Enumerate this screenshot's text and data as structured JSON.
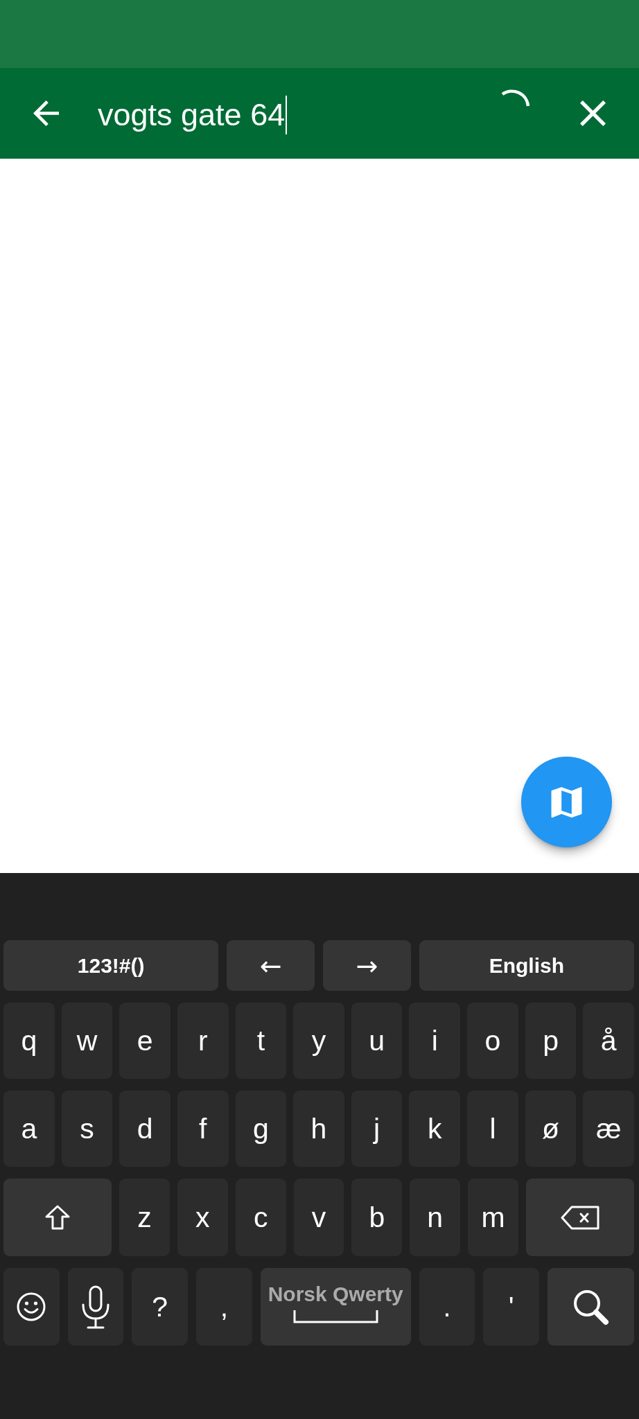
{
  "search_bar": {
    "query": "vogts gate 64",
    "loading": true
  },
  "keyboard": {
    "rows": [
      {
        "keys": [
          {
            "kind": "text",
            "label": "123!#()"
          },
          {
            "kind": "nav",
            "label": "←"
          },
          {
            "kind": "nav",
            "label": "→"
          },
          {
            "kind": "text",
            "label": "English"
          }
        ]
      },
      {
        "keys": [
          {
            "kind": "char",
            "label": "q"
          },
          {
            "kind": "char",
            "label": "w"
          },
          {
            "kind": "char",
            "label": "e"
          },
          {
            "kind": "char",
            "label": "r"
          },
          {
            "kind": "char",
            "label": "t"
          },
          {
            "kind": "char",
            "label": "y"
          },
          {
            "kind": "char",
            "label": "u"
          },
          {
            "kind": "char",
            "label": "i"
          },
          {
            "kind": "char",
            "label": "o"
          },
          {
            "kind": "char",
            "label": "p"
          },
          {
            "kind": "char",
            "label": "å"
          }
        ]
      },
      {
        "keys": [
          {
            "kind": "char",
            "label": "a"
          },
          {
            "kind": "char",
            "label": "s"
          },
          {
            "kind": "char",
            "label": "d"
          },
          {
            "kind": "char",
            "label": "f"
          },
          {
            "kind": "char",
            "label": "g"
          },
          {
            "kind": "char",
            "label": "h"
          },
          {
            "kind": "char",
            "label": "j"
          },
          {
            "kind": "char",
            "label": "k"
          },
          {
            "kind": "char",
            "label": "l"
          },
          {
            "kind": "char",
            "label": "ø"
          },
          {
            "kind": "char",
            "label": "æ"
          }
        ]
      },
      {
        "keys": [
          {
            "kind": "shift"
          },
          {
            "kind": "char",
            "label": "z"
          },
          {
            "kind": "char",
            "label": "x"
          },
          {
            "kind": "char",
            "label": "c"
          },
          {
            "kind": "char",
            "label": "v"
          },
          {
            "kind": "char",
            "label": "b"
          },
          {
            "kind": "char",
            "label": "n"
          },
          {
            "kind": "char",
            "label": "m"
          },
          {
            "kind": "backspace"
          }
        ]
      },
      {
        "keys": [
          {
            "kind": "emoji"
          },
          {
            "kind": "mic"
          },
          {
            "kind": "char",
            "label": "?"
          },
          {
            "kind": "char",
            "label": ","
          },
          {
            "kind": "space",
            "label": "Norsk Qwerty"
          },
          {
            "kind": "char",
            "label": "."
          },
          {
            "kind": "char",
            "label": "'"
          },
          {
            "kind": "search"
          }
        ]
      }
    ]
  }
}
